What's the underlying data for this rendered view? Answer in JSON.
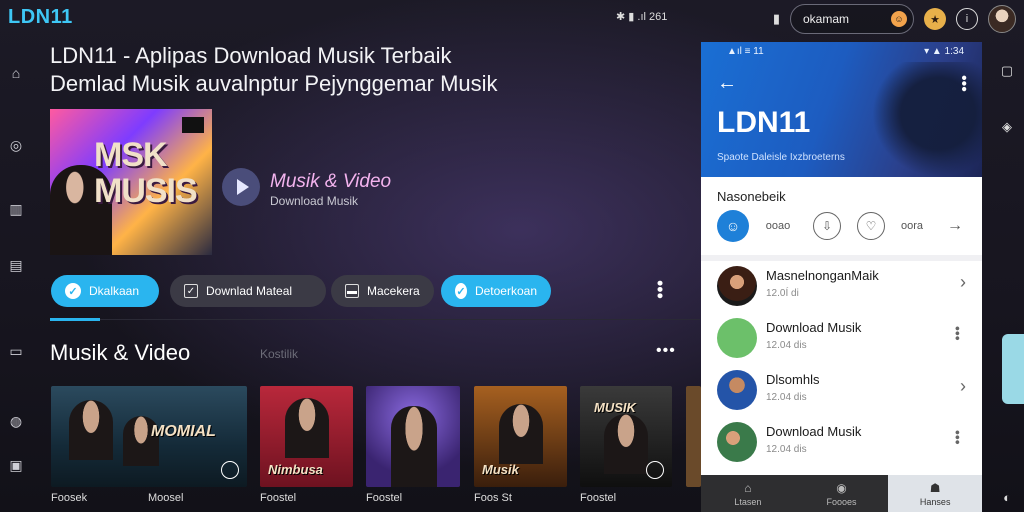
{
  "app": {
    "title": "LDN11"
  },
  "status_bar": {
    "left": "✱ ▮ .ıl 261"
  },
  "search": {
    "value": "okamam"
  },
  "hero": {
    "title_line1": "LDN11 - Aplipas Download Musik Terbaik",
    "title_line2": "Demlad Musik auvalnptur Pejynggemar Musik",
    "cover_text": "MSK MUSIS",
    "subtitle": "Musik & Video",
    "caption": "Download Musik"
  },
  "chips": [
    {
      "label": "Dkalkaan",
      "style": "blue"
    },
    {
      "label": "Downlad Mateal",
      "style": "grey"
    },
    {
      "label": "Macekera",
      "style": "grey"
    },
    {
      "label": "Detoerkoan",
      "style": "blue"
    }
  ],
  "section": {
    "title": "Musik & Video",
    "tag": "Kostilik"
  },
  "tiles": [
    {
      "text": "MOMIAL",
      "caption": "Foosek",
      "caption2": "Moosel"
    },
    {
      "text": "Nimbusa",
      "caption": "Foostel"
    },
    {
      "text": "",
      "caption": "Foostel"
    },
    {
      "text": "Musik",
      "caption": "Foos St"
    },
    {
      "text": "MUSIK",
      "caption": "Foostel"
    }
  ],
  "phone": {
    "status_left": "▲ıl ≡ 11",
    "status_right": "▾ ▲ 1:34",
    "title": "LDN11",
    "subtitle": "Spaote Daleisle Ixzbroeterns",
    "section_label": "Nasonebeik",
    "actions": [
      {
        "label": "ooao"
      },
      {
        "label": "oora"
      }
    ],
    "rows": [
      {
        "title": "MasnelnonganMaik",
        "meta": "12.0Í di",
        "trail": "chevron"
      },
      {
        "title": "Download Musik",
        "meta": "12.04 dis",
        "trail": "more"
      },
      {
        "title": "Dlsomhls",
        "meta": "12.04 dis",
        "trail": "chevron"
      },
      {
        "title": "Download Musik",
        "meta": "12.04 dis",
        "trail": "more"
      }
    ],
    "nav": [
      {
        "label": "Ltasen",
        "icon": "home-icon"
      },
      {
        "label": "Foooes",
        "icon": "disc-icon"
      },
      {
        "label": "Hanses",
        "icon": "profile-icon",
        "active": true
      }
    ]
  },
  "colors": {
    "accent": "#2ab5ef",
    "phone_header": "#1d5cc0",
    "pink": "#f3b3ee"
  }
}
